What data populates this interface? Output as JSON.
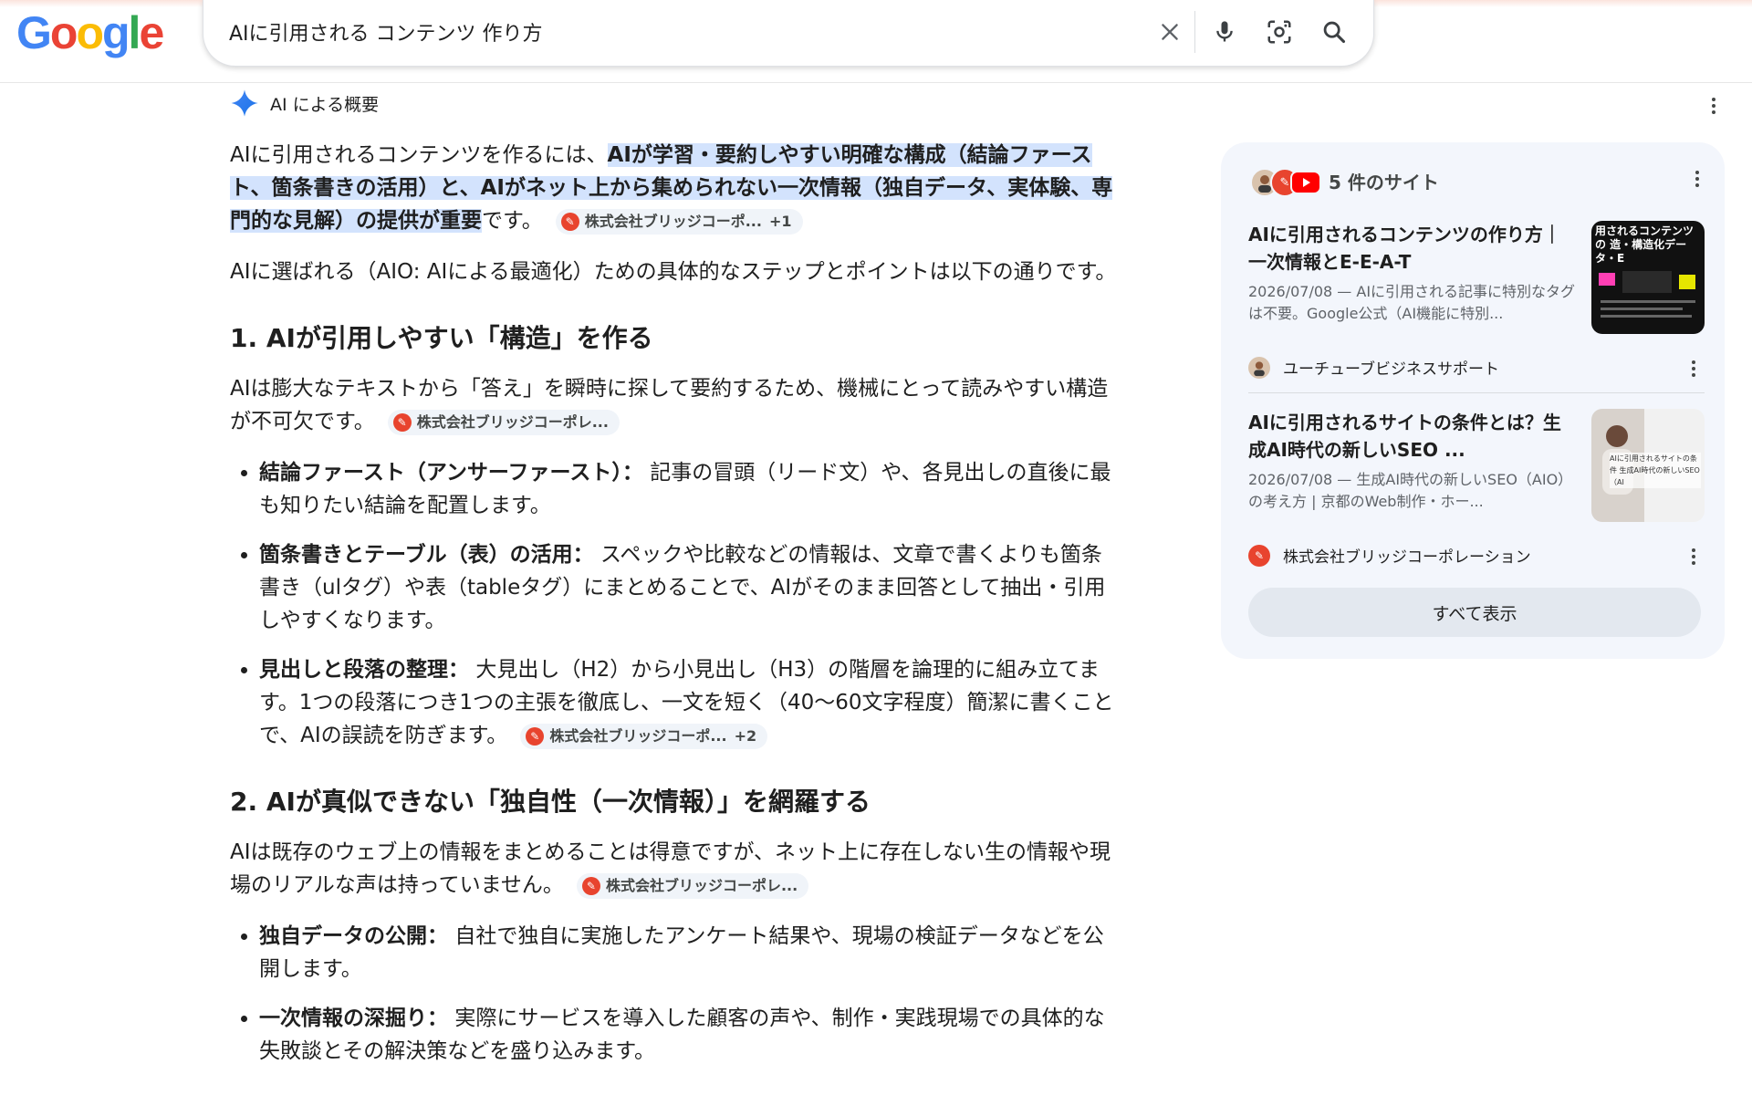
{
  "search": {
    "query": "AIに引用される コンテンツ 作り方"
  },
  "logo": {
    "letters": [
      "G",
      "o",
      "o",
      "g",
      "l",
      "e"
    ]
  },
  "ai_overview": {
    "label": "AI による概要",
    "intro_plain": "AIに引用されるコンテンツを作るには、",
    "intro_highlight": "AIが学習・要約しやすい明確な構成（結論ファースト、箇条書きの活用）と、AIがネット上から集められない一次情報（独自データ、実体験、専門的な見解）の提供が重要",
    "intro_end": "です。",
    "intro_chip": "株式会社ブリッジコーポ...",
    "intro_chip_plus": "+1",
    "p2": "AIに選ばれる（AIO: AIによる最適化）ための具体的なステップとポイントは以下の通りです。",
    "sections": [
      {
        "heading": "1. AIが引用しやすい「構造」を作る",
        "body": "AIは膨大なテキストから「答え」を瞬時に探して要約するため、機械にとって読みやすい構造が不可欠です。",
        "chip": "株式会社ブリッジコーポレ...",
        "bullets": [
          {
            "title": "結論ファースト（アンサーファースト）：",
            "text": "記事の冒頭（リード文）や、各見出しの直後に最も知りたい結論を配置します。"
          },
          {
            "title": "箇条書きとテーブル（表）の活用：",
            "text": "スペックや比較などの情報は、文章で書くよりも箇条書き（ulタグ）や表（tableタグ）にまとめることで、AIがそのまま回答として抽出・引用しやすくなります。"
          },
          {
            "title": "見出しと段落の整理：",
            "text": "大見出し（H2）から小見出し（H3）の階層を論理的に組み立てます。1つの段落につき1つの主張を徹底し、一文を短く（40〜60文字程度）簡潔に書くことで、AIの誤読を防ぎます。",
            "chip": "株式会社ブリッジコーポ...",
            "chip_plus": "+2"
          }
        ]
      },
      {
        "heading": "2. AIが真似できない「独自性（一次情報）」を網羅する",
        "body": "AIは既存のウェブ上の情報をまとめることは得意ですが、ネット上に存在しない生の情報や現場のリアルな声は持っていません。",
        "chip": "株式会社ブリッジコーポレ...",
        "bullets": [
          {
            "title": "独自データの公開：",
            "text": "自社で独自に実施したアンケート結果や、現場の検証データなどを公開します。"
          },
          {
            "title": "一次情報の深掘り：",
            "text": "実際にサービスを導入した顧客の声や、制作・実践現場での具体的な失敗談とその解決策などを盛り込みます。"
          }
        ]
      }
    ]
  },
  "sources_panel": {
    "count_label": "5 件のサイト",
    "cards": [
      {
        "title": "AIに引用されるコンテンツの作り方｜一次情報とE-E-A-T",
        "snippet": "2026/07/08 — AIに引用される記事に特別なタグは不要。Google公式（AI機能に特別...",
        "source": "ユーチューブビジネスサポート",
        "thumb_text": "用されるコンテンツの 造・構造化データ・E"
      },
      {
        "title": "AIに引用されるサイトの条件とは？生成AI時代の新しいSEO ...",
        "snippet": "2026/07/08 — 生成AI時代の新しいSEO（AIO）の考え方 | 京都のWeb制作・ホー...",
        "source": "株式会社ブリッジコーポレーション",
        "thumb_text": "AIに引用されるサイトの条件 生成AI時代の新しいSEO（AI"
      }
    ],
    "show_all": "すべて表示"
  },
  "colors": {
    "highlight": "#d3e3fd",
    "panel_bg": "#f3f6fc",
    "chip_bg": "#f0f4f9",
    "bridge_red": "#e8442e"
  }
}
